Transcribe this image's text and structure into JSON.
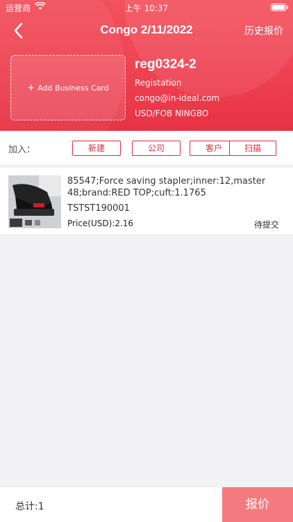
{
  "status_bar": {
    "carrier": "运营商",
    "time": "上午 10:37"
  },
  "nav": {
    "title": "Congo 2/11/2022",
    "right_label": "历史报价"
  },
  "card": {
    "add_label": "Add Business Card"
  },
  "customer": {
    "name": "reg0324-2",
    "type": "Registation",
    "email": "congo@in-ideal.com",
    "terms": "USD/FOB NINGBO"
  },
  "add_bar": {
    "label": "加入：",
    "buttons": [
      "新建",
      "公司",
      "客户",
      "扫描"
    ]
  },
  "products": [
    {
      "description": "85547;Force saving stapler;inner:12,master 48;brand:RED TOP;cuft:1.1765",
      "code": "TSTST190001",
      "price": "Price(USD):2.16",
      "status": "待提交"
    }
  ],
  "footer": {
    "total": "总计:1",
    "quote_label": "报价"
  },
  "colors": {
    "accent": "#e63244",
    "chip": "#e0283a",
    "quote_button": "#f47a7f"
  },
  "icons": {
    "back": "chevron-left-icon",
    "wifi": "wifi-icon",
    "battery": "battery-icon",
    "plus": "plus-icon"
  }
}
